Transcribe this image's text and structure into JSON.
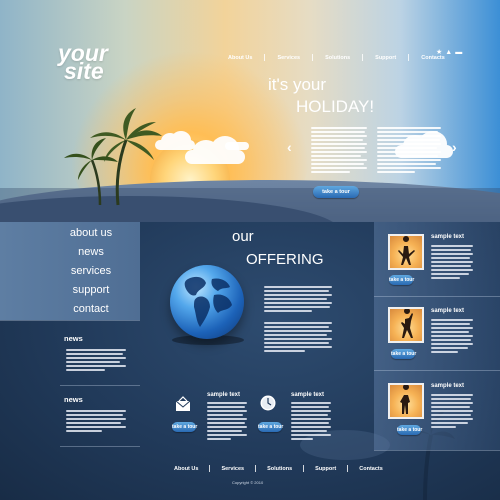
{
  "logo": {
    "line1": "your",
    "line2": "site"
  },
  "top_nav": {
    "items": [
      "About Us",
      "Services",
      "Solutions",
      "Support",
      "Contacts"
    ]
  },
  "tool_icons": [
    "star-icon",
    "home-icon",
    "mail-icon"
  ],
  "hero": {
    "title_line1": "it's your",
    "title_line2": "HOLIDAY!",
    "button_label": "take a tour"
  },
  "side_menu": {
    "items": [
      "about us",
      "news",
      "services",
      "support",
      "contact"
    ]
  },
  "news": [
    {
      "title": "news"
    },
    {
      "title": "news"
    }
  ],
  "offering": {
    "line1": "our",
    "line2": "OFFERING"
  },
  "features": [
    {
      "title": "sample text",
      "button_label": "take a tour",
      "icon": "mail-envelope-icon"
    },
    {
      "title": "sample text",
      "button_label": "take a tour",
      "icon": "clock-icon"
    }
  ],
  "right_samples": [
    {
      "title": "sample text",
      "button_label": "take a tour"
    },
    {
      "title": "sample text",
      "button_label": "take a tour"
    },
    {
      "title": "sample text",
      "button_label": "take a tour"
    }
  ],
  "bottom_nav": {
    "items": [
      "About Us",
      "Services",
      "Solutions",
      "Support",
      "Contacts"
    ]
  },
  "copyright": "Copyright © 2010",
  "colors": {
    "main_background": "#213a5a",
    "left_panel": "#5e7ea3",
    "button": "#2a6ab3",
    "sky_right": "#3c8fd6",
    "sun": "#ffbe55"
  }
}
